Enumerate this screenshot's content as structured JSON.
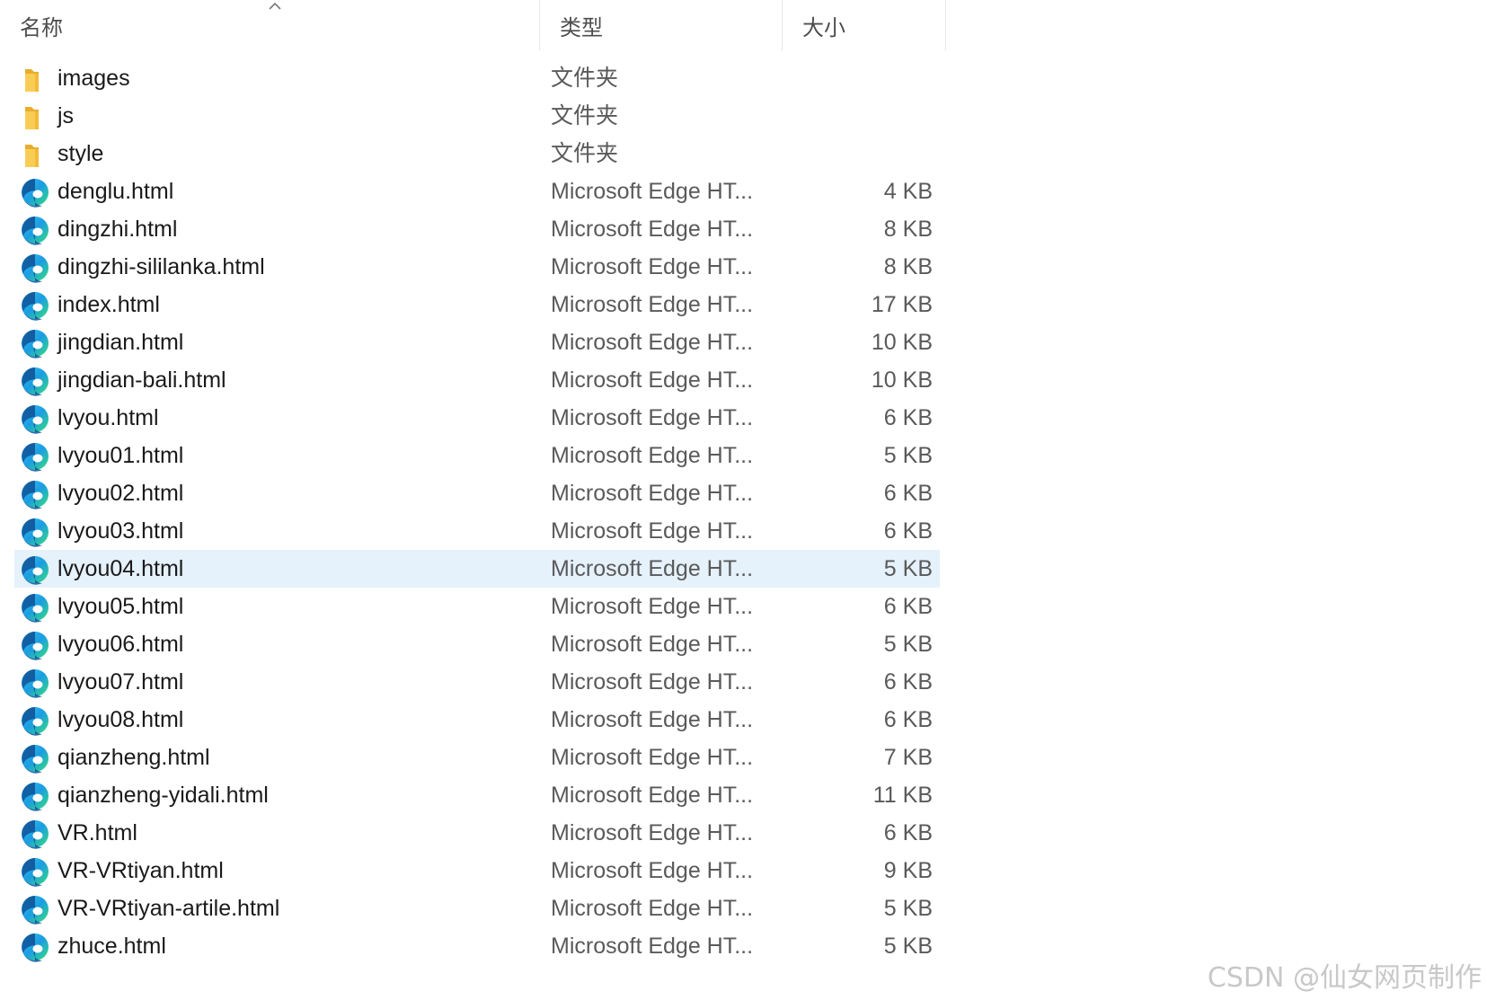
{
  "header": {
    "name_label": "名称",
    "type_label": "类型",
    "size_label": "大小",
    "sort_icon": "chevron-up-icon"
  },
  "files": [
    {
      "name": "images",
      "type": "文件夹",
      "size": "",
      "icon": "folder-icon"
    },
    {
      "name": "js",
      "type": "文件夹",
      "size": "",
      "icon": "folder-icon"
    },
    {
      "name": "style",
      "type": "文件夹",
      "size": "",
      "icon": "folder-icon"
    },
    {
      "name": "denglu.html",
      "type": "Microsoft Edge HT...",
      "size": "4 KB",
      "icon": "edge-icon"
    },
    {
      "name": "dingzhi.html",
      "type": "Microsoft Edge HT...",
      "size": "8 KB",
      "icon": "edge-icon"
    },
    {
      "name": "dingzhi-sililanka.html",
      "type": "Microsoft Edge HT...",
      "size": "8 KB",
      "icon": "edge-icon"
    },
    {
      "name": "index.html",
      "type": "Microsoft Edge HT...",
      "size": "17 KB",
      "icon": "edge-icon"
    },
    {
      "name": "jingdian.html",
      "type": "Microsoft Edge HT...",
      "size": "10 KB",
      "icon": "edge-icon"
    },
    {
      "name": "jingdian-bali.html",
      "type": "Microsoft Edge HT...",
      "size": "10 KB",
      "icon": "edge-icon"
    },
    {
      "name": "lvyou.html",
      "type": "Microsoft Edge HT...",
      "size": "6 KB",
      "icon": "edge-icon"
    },
    {
      "name": "lvyou01.html",
      "type": "Microsoft Edge HT...",
      "size": "5 KB",
      "icon": "edge-icon"
    },
    {
      "name": "lvyou02.html",
      "type": "Microsoft Edge HT...",
      "size": "6 KB",
      "icon": "edge-icon"
    },
    {
      "name": "lvyou03.html",
      "type": "Microsoft Edge HT...",
      "size": "6 KB",
      "icon": "edge-icon"
    },
    {
      "name": "lvyou04.html",
      "type": "Microsoft Edge HT...",
      "size": "5 KB",
      "icon": "edge-icon",
      "selected": true
    },
    {
      "name": "lvyou05.html",
      "type": "Microsoft Edge HT...",
      "size": "6 KB",
      "icon": "edge-icon"
    },
    {
      "name": "lvyou06.html",
      "type": "Microsoft Edge HT...",
      "size": "5 KB",
      "icon": "edge-icon"
    },
    {
      "name": "lvyou07.html",
      "type": "Microsoft Edge HT...",
      "size": "6 KB",
      "icon": "edge-icon"
    },
    {
      "name": "lvyou08.html",
      "type": "Microsoft Edge HT...",
      "size": "6 KB",
      "icon": "edge-icon"
    },
    {
      "name": "qianzheng.html",
      "type": "Microsoft Edge HT...",
      "size": "7 KB",
      "icon": "edge-icon"
    },
    {
      "name": "qianzheng-yidali.html",
      "type": "Microsoft Edge HT...",
      "size": "11 KB",
      "icon": "edge-icon"
    },
    {
      "name": "VR.html",
      "type": "Microsoft Edge HT...",
      "size": "6 KB",
      "icon": "edge-icon"
    },
    {
      "name": "VR-VRtiyan.html",
      "type": "Microsoft Edge HT...",
      "size": "9 KB",
      "icon": "edge-icon"
    },
    {
      "name": "VR-VRtiyan-artile.html",
      "type": "Microsoft Edge HT...",
      "size": "5 KB",
      "icon": "edge-icon"
    },
    {
      "name": "zhuce.html",
      "type": "Microsoft Edge HT...",
      "size": "5 KB",
      "icon": "edge-icon"
    }
  ],
  "colors": {
    "selection": "#e5f1fb",
    "folder": "#f7c948",
    "edge_blue": "#1177d4",
    "edge_green": "#3fc35a"
  },
  "watermark": "CSDN @仙女网页制作"
}
